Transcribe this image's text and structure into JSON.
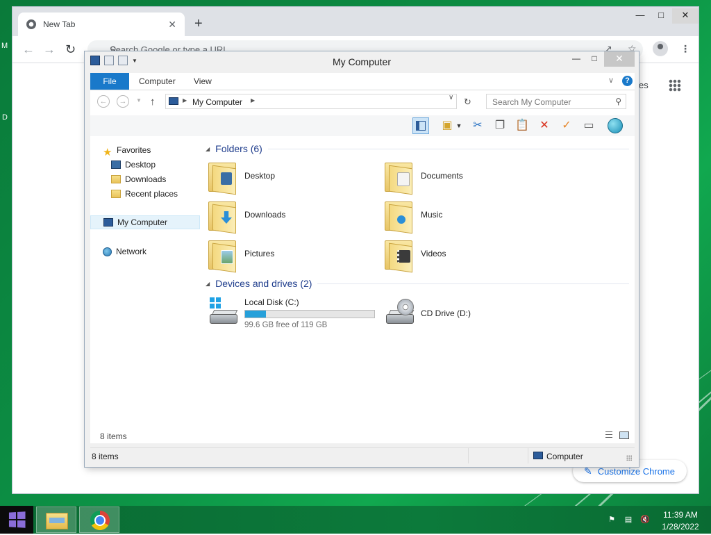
{
  "desktop": {
    "frag_left_top": "M",
    "frag_left_mid": "D"
  },
  "chrome": {
    "tab_title": "New Tab",
    "tab_close": "✕",
    "new_tab": "+",
    "omnibox_placeholder": "Search Google or type a URL",
    "apps_fragment": "es",
    "customize_label": "Customize Chrome"
  },
  "explorer": {
    "title": "My Computer",
    "ribbon_tabs": [
      "File",
      "Computer",
      "View"
    ],
    "address": "My Computer",
    "search_placeholder": "Search My Computer",
    "nav_pane": {
      "favorites": "Favorites",
      "desktop": "Desktop",
      "downloads": "Downloads",
      "recent": "Recent places",
      "computer": "My Computer",
      "network": "Network"
    },
    "folders_header": "Folders (6)",
    "folders": [
      "Desktop",
      "Documents",
      "Downloads",
      "Music",
      "Pictures",
      "Videos"
    ],
    "drives_header": "Devices and drives (2)",
    "drives": [
      {
        "label": "Local Disk (C:)",
        "free_text": "99.6 GB free of 119 GB",
        "used_fraction": 0.163
      },
      {
        "label": "CD Drive (D:)"
      }
    ],
    "footer_count": "8 items",
    "status_count": "8 items",
    "status_location": "Computer"
  },
  "taskbar": {
    "time": "11:39 AM",
    "date": "1/28/2022"
  },
  "colors": {
    "accent": "#1979ca",
    "desktop_green": "#0c8f44",
    "usage_fill": "#26a0da"
  }
}
